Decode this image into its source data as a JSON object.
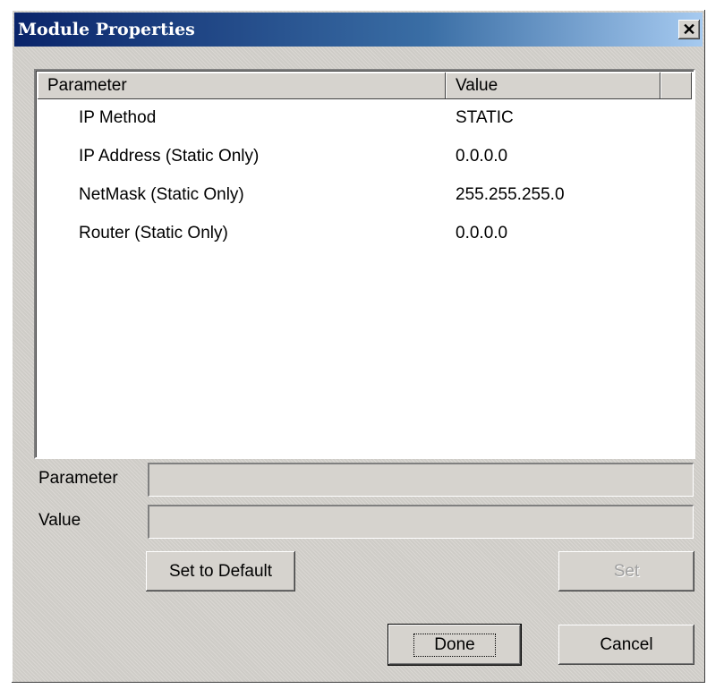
{
  "window": {
    "title": "Module Properties",
    "close_glyph": "✕"
  },
  "list": {
    "columns": [
      "Parameter",
      "Value"
    ],
    "rows": [
      {
        "parameter": "IP Method",
        "value": "STATIC"
      },
      {
        "parameter": "IP Address (Static Only)",
        "value": "0.0.0.0"
      },
      {
        "parameter": "NetMask (Static Only)",
        "value": "255.255.255.0"
      },
      {
        "parameter": "Router (Static Only)",
        "value": "0.0.0.0"
      }
    ]
  },
  "editor": {
    "parameter_label": "Parameter",
    "parameter_value": "",
    "value_label": "Value",
    "value_value": ""
  },
  "buttons": {
    "set_to_default": "Set to Default",
    "set": "Set",
    "done": "Done",
    "cancel": "Cancel"
  },
  "icons": {
    "close": "close-icon"
  },
  "colors": {
    "titlebar_start": "#0a246a",
    "titlebar_end": "#a6caf0",
    "dialog_face": "#d6d3ce",
    "disabled_text": "#a0a0a0"
  }
}
